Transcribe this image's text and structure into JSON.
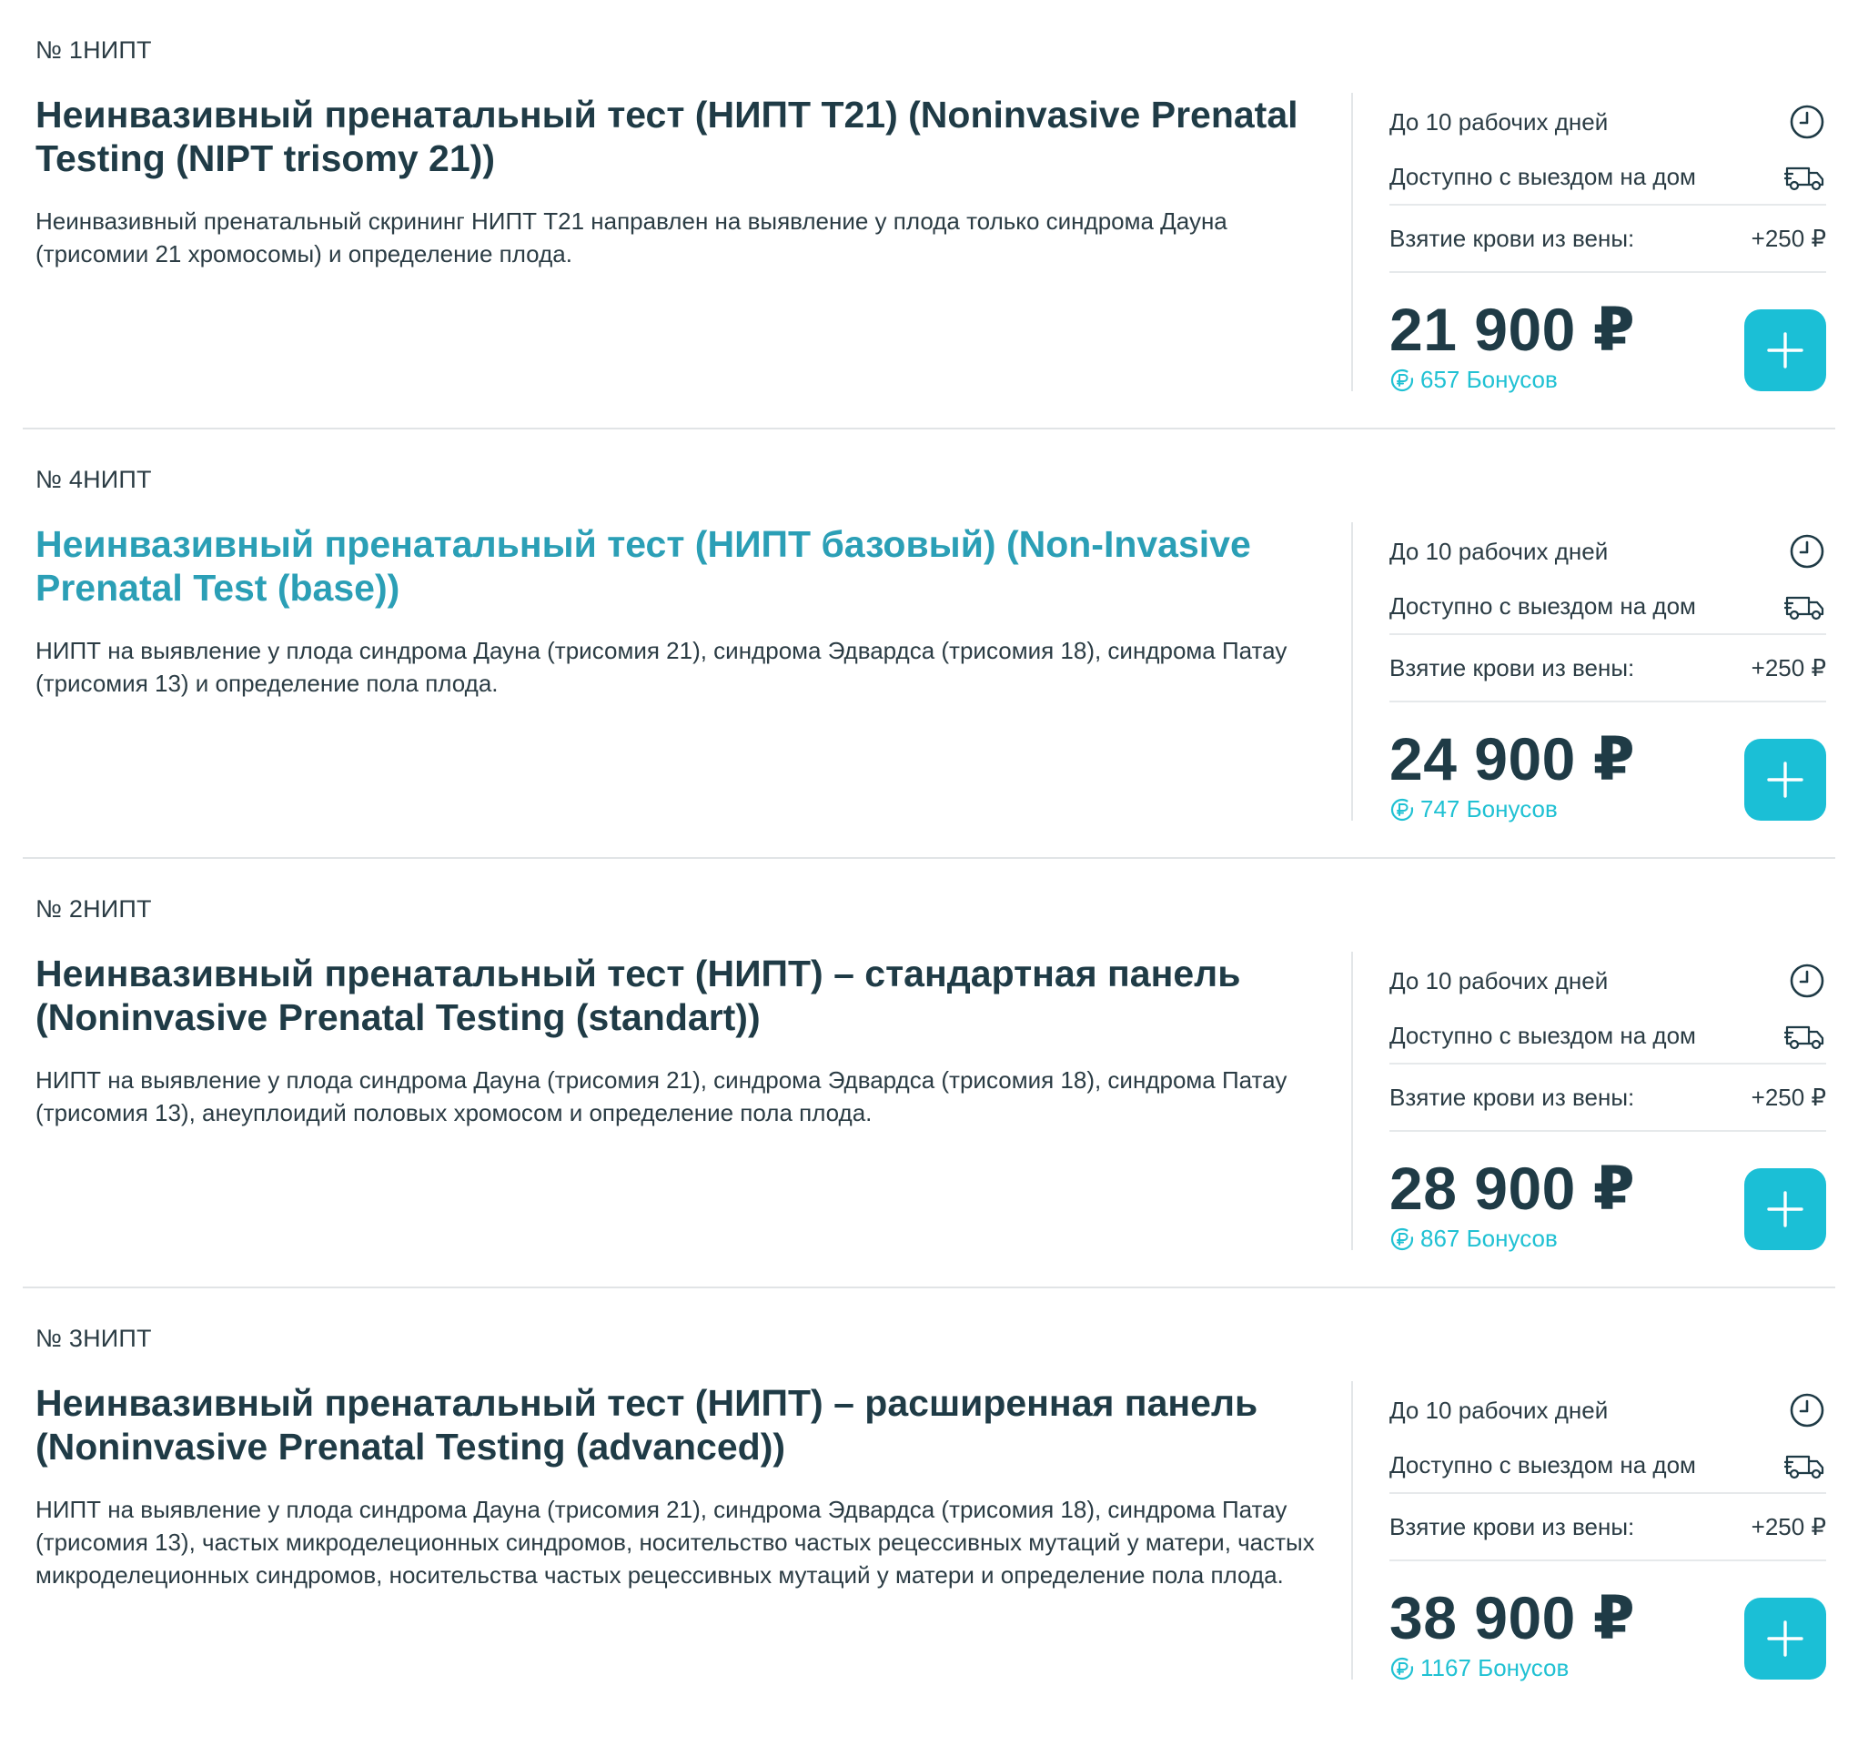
{
  "items": [
    {
      "code": "№ 1НИПТ",
      "title": "Неинвазивный пренатальный тест (НИПТ Т21) (Noninvasive Prenatal Testing (NIPT trisomy 21))",
      "description": "Неинвазивный пренатальный скрининг НИПТ Т21 направлен на выявление у плода только синдрома Дауна (трисомии 21 хромосомы) и определение плода.",
      "turnaround": "До 10 рабочих дней",
      "home_visit": "Доступно с выездом на дом",
      "blood_draw_label": "Взятие крови из вены:",
      "blood_draw_price": "+250 ₽",
      "price": "21 900 ₽",
      "bonus": "657 Бонусов",
      "active": false
    },
    {
      "code": "№ 4НИПТ",
      "title": "Неинвазивный пренатальный тест (НИПТ базовый) (Non-Invasive Prenatal Test (base))",
      "description": "НИПТ на выявление у плода синдрома Дауна (трисомия 21), синдрома Эдвардса (трисомия 18), синдрома Патау (трисомия 13) и определение пола плода.",
      "turnaround": "До 10 рабочих дней",
      "home_visit": "Доступно с выездом на дом",
      "blood_draw_label": "Взятие крови из вены:",
      "blood_draw_price": "+250 ₽",
      "price": "24 900 ₽",
      "bonus": "747 Бонусов",
      "active": true
    },
    {
      "code": "№ 2НИПТ",
      "title": "Неинвазивный пренатальный тест (НИПТ) – стандартная панель (Noninvasive Prenatal Testing (standart))",
      "description": "НИПТ на выявление у плода синдрома Дауна (трисомия 21), синдрома Эдвардса (трисомия 18), синдрома Патау (трисомия 13), анеуплоидий половых хромосом и определение пола плода.",
      "turnaround": "До 10 рабочих дней",
      "home_visit": "Доступно с выездом на дом",
      "blood_draw_label": "Взятие крови из вены:",
      "blood_draw_price": "+250 ₽",
      "price": "28 900 ₽",
      "bonus": "867 Бонусов",
      "active": false
    },
    {
      "code": "№ 3НИПТ",
      "title": "Неинвазивный пренатальный тест (НИПТ) – расширенная панель (Noninvasive Prenatal Testing (advanced))",
      "description": "НИПТ на выявление у плода синдрома Дауна (трисомия 21), синдрома Эдвардса (трисомия 18), синдрома Патау (трисомия 13), частых микроделеционных синдромов, носительство частых рецессивных мутаций у матери, частых микроделеционных синдромов, носительства частых рецессивных мутаций у матери и определение пола плода.",
      "turnaround": "До 10 рабочих дней",
      "home_visit": "Доступно с выездом на дом",
      "blood_draw_label": "Взятие крови из вены:",
      "blood_draw_price": "+250 ₽",
      "price": "38 900 ₽",
      "bonus": "1167 Бонусов",
      "active": false
    }
  ],
  "icons": {
    "clock": "clock-icon",
    "delivery": "truck-icon",
    "bonus": "ruble-coin-icon",
    "add": "plus-icon"
  },
  "colors": {
    "title_default": "#1f3b46",
    "title_active": "#2b9fb6",
    "accent": "#1bbfd6",
    "bonus": "#20c1d3",
    "divider": "#e1e4e6"
  }
}
